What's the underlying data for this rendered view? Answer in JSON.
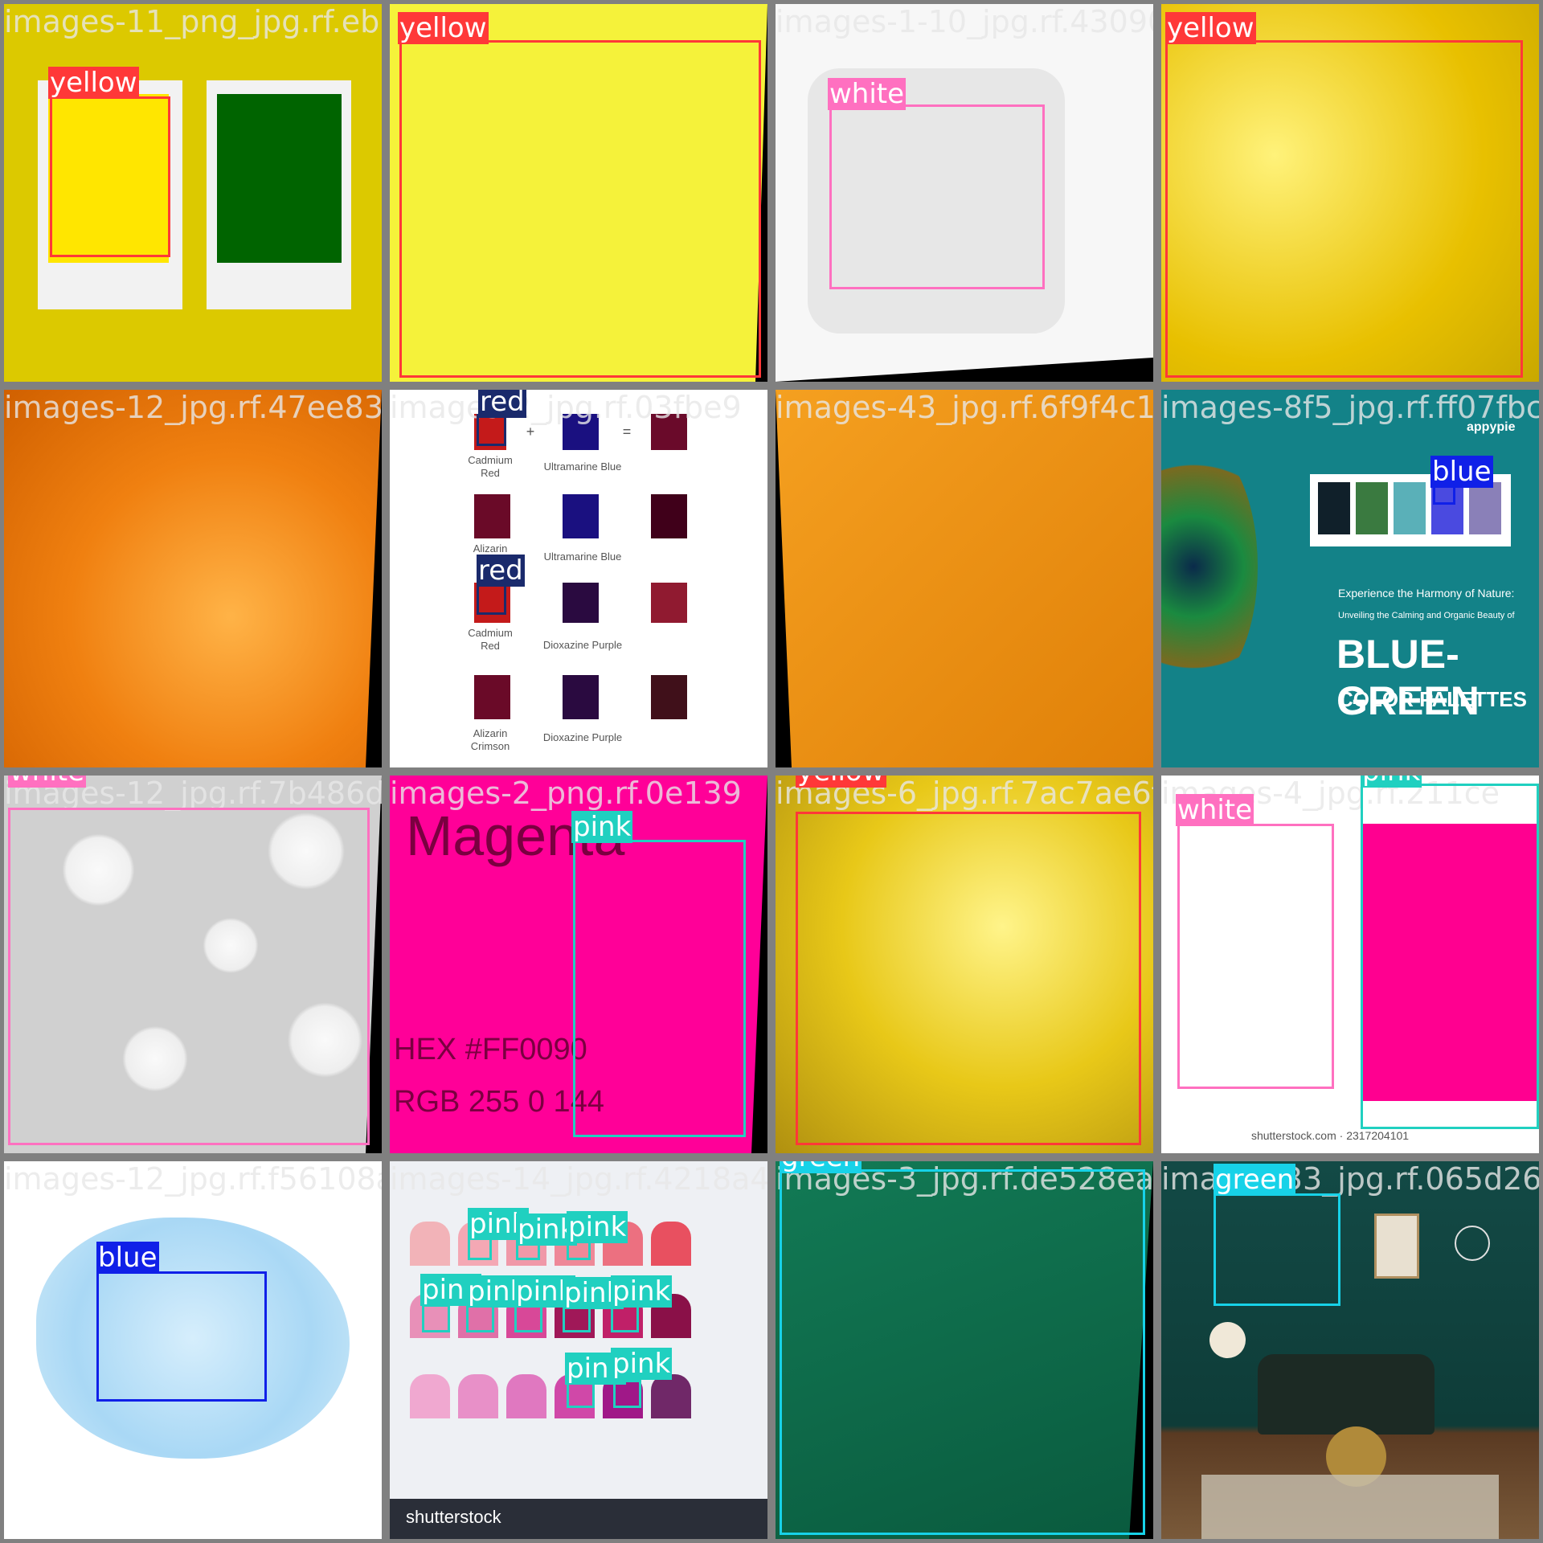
{
  "tiles": [
    {
      "filename": "images-11_png_jpg.rf.eb53e",
      "labels": [
        "yellow"
      ]
    },
    {
      "filename": "yellow",
      "labels": [
        "yellow"
      ]
    },
    {
      "filename": "images-1-10_jpg.rf.430902ca5",
      "labels": [
        "white"
      ]
    },
    {
      "filename": "yellow",
      "labels": [
        "yellow"
      ]
    },
    {
      "filename": "images-12_jpg.rf.47ee83f77",
      "labels": [
        "orange"
      ]
    },
    {
      "filename": "images-2_jpg.rf.03fbe9",
      "labels": [
        "red",
        "red"
      ],
      "text": {
        "r1a": "Cadmium",
        "r1b": "Red",
        "r1m": "Ultramarine Blue",
        "r2a": "Alizarin",
        "r2m": "Ultramarine Blue",
        "r3a": "Cadmium",
        "r3b": "Red",
        "r3m": "Dioxazine Purple",
        "r4a": "Alizarin",
        "r4b": "Crimson",
        "r4m": "Dioxazine Purple",
        "plus": "+",
        "equals": "="
      }
    },
    {
      "filename": "images-43_jpg.rf.6f9f4c197",
      "labels": [
        "orange"
      ]
    },
    {
      "filename": "images-8f5_jpg.rf.ff07fbc95c",
      "labels": [
        "blue"
      ],
      "text": {
        "brand": "appypie",
        "line1": "Experience the Harmony of Nature:",
        "line2": "Unveiling the Calming and Organic Beauty of",
        "title": "BLUE-GREEN",
        "sub": "COLOR PALETTES"
      }
    },
    {
      "filename": "images-12_jpg.rf.7b486d3a7",
      "labels": [
        "white"
      ]
    },
    {
      "filename": "images-2_png.rf.0e139",
      "labels": [
        "pink"
      ],
      "text": {
        "title": "Magenta",
        "hex": "HEX #FF0090",
        "rgb": "RGB 255 0 144"
      }
    },
    {
      "filename": "images-6_jpg.rf.7ac7ae6f",
      "labels": [
        "yellow"
      ]
    },
    {
      "filename": "images-4_jpg.rf.211ce",
      "labels": [
        "white",
        "pink"
      ],
      "text": {
        "credit": "shutterstock.com · 2317204101"
      }
    },
    {
      "filename": "images-12_jpg.rf.f56108a30",
      "labels": [
        "blue"
      ]
    },
    {
      "filename": "images-14_jpg.rf.4218a44e",
      "labels": [
        "pink",
        "pink",
        "pink",
        "pink",
        "pink",
        "pink",
        "pink",
        "pink",
        "pink",
        "pink"
      ],
      "text": {
        "brand": "shutterstock"
      }
    },
    {
      "filename": "images-3_jpg.rf.de528eaf9",
      "labels": [
        "green"
      ]
    },
    {
      "filename": "images-33_jpg.rf.065d2675a",
      "labels": [
        "green"
      ]
    }
  ],
  "colors": {
    "yellow": "#ff3838",
    "white": "#ff70c0",
    "orange": "#fafafa",
    "red": "#1a2a6c",
    "blue": "#1020e8",
    "pink": "#20d0c0",
    "green": "#17d2e8"
  }
}
